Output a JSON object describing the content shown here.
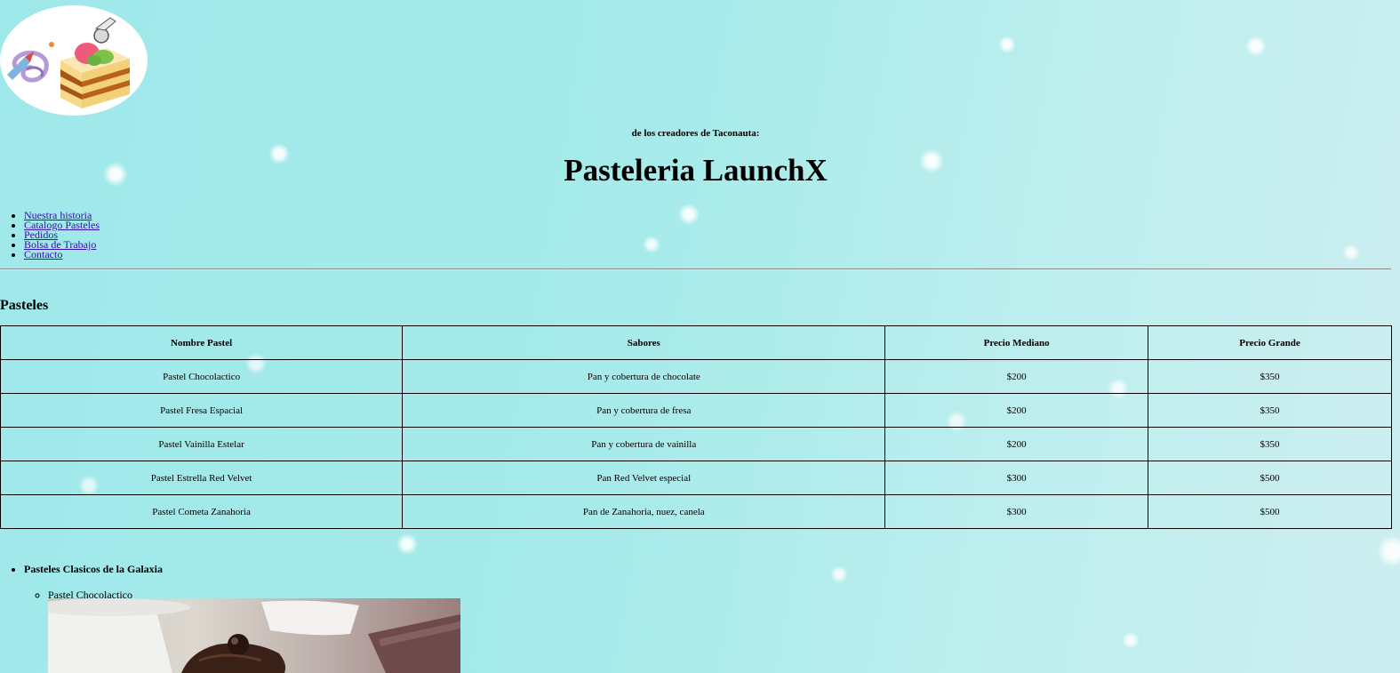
{
  "header": {
    "logo_alt": "Pasteleria LaunchX logo",
    "subtitle": "de los creadores de Taconauta:",
    "title": "Pasteleria LaunchX"
  },
  "nav": {
    "items": [
      {
        "label": "Nuestra historia"
      },
      {
        "label": "Catalogo Pasteles"
      },
      {
        "label": "Pedidos"
      },
      {
        "label": "Bolsa de Trabajo"
      },
      {
        "label": "Contacto"
      }
    ]
  },
  "section": {
    "title": "Pasteles"
  },
  "table": {
    "headers": [
      "Nombre Pastel",
      "Sabores",
      "Precio Mediano",
      "Precio Grande"
    ],
    "rows": [
      [
        "Pastel Chocolactico",
        "Pan y cobertura de chocolate",
        "$200",
        "$350"
      ],
      [
        "Pastel Fresa Espacial",
        "Pan y cobertura de fresa",
        "$200",
        "$350"
      ],
      [
        "Pastel Vainilla Estelar",
        "Pan y cobertura de vainilla",
        "$200",
        "$350"
      ],
      [
        "Pastel Estrella Red Velvet",
        "Pan Red Velvet especial",
        "$300",
        "$500"
      ],
      [
        "Pastel Cometa Zanahoria",
        "Pan de Zanahoria, nuez, canela",
        "$300",
        "$500"
      ]
    ]
  },
  "classics": {
    "heading": "Pasteles Clasicos de la Galaxia",
    "items": [
      {
        "label": "Pastel Chocolactico"
      }
    ]
  },
  "colors": {
    "background": "#a6ebea",
    "link": "#3a0ea8",
    "text": "#000000"
  }
}
